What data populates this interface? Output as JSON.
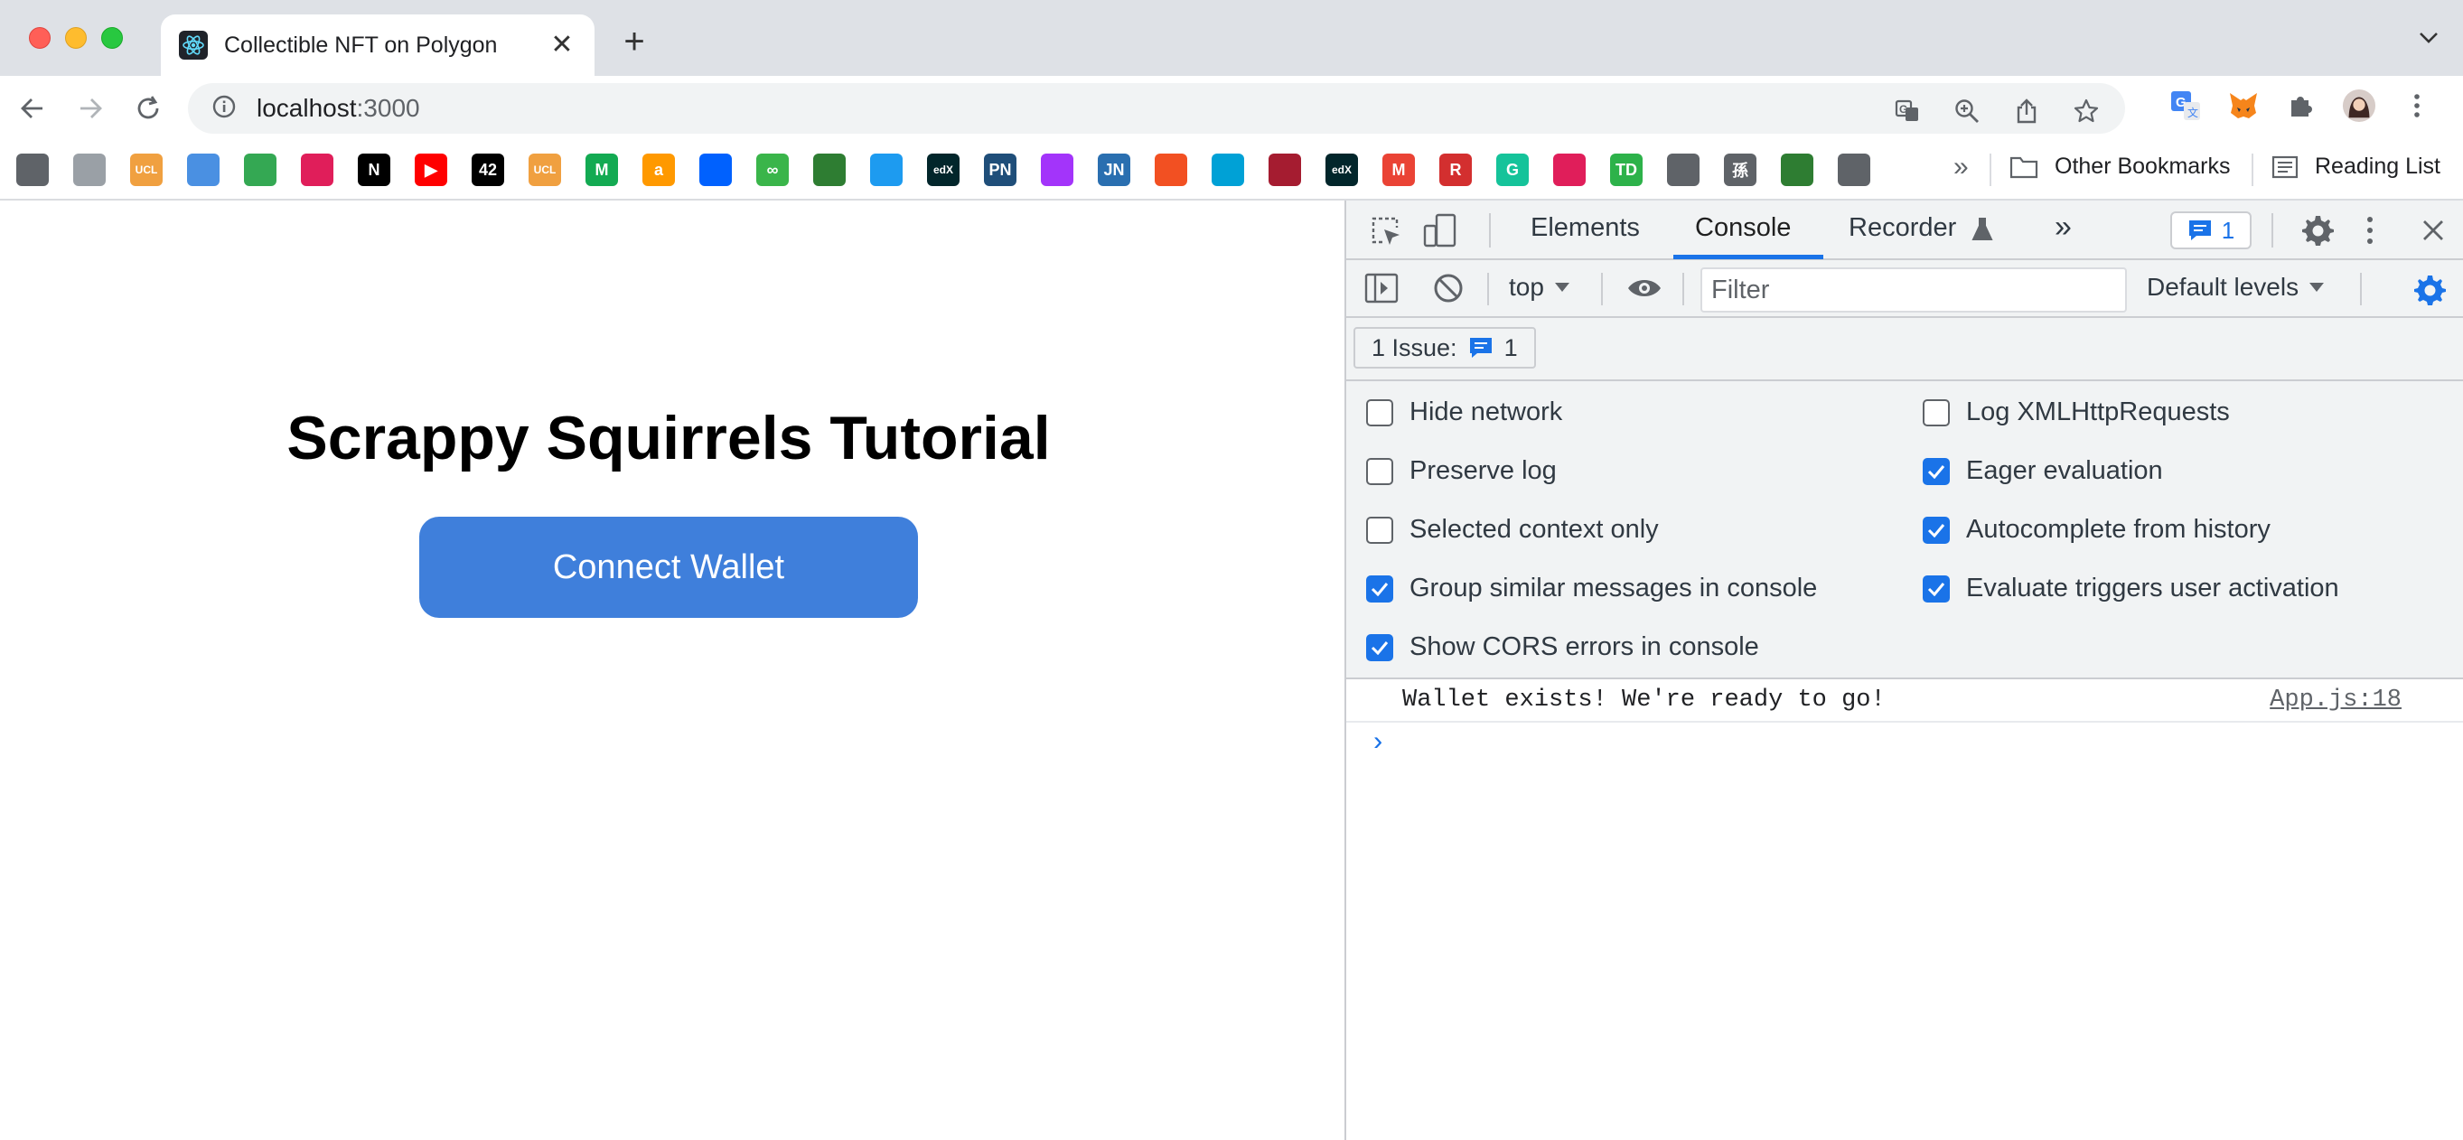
{
  "browser": {
    "tab_title": "Collectible NFT on Polygon",
    "new_tab_glyph": "+",
    "close_glyph": "✕",
    "url_host": "localhost",
    "url_port": ":3000"
  },
  "bookmarks": {
    "icons": [
      {
        "name": "globe-icon",
        "color": "#5f6368",
        "text": ""
      },
      {
        "name": "globe-gray-icon",
        "color": "#9aa0a6",
        "text": ""
      },
      {
        "name": "ucl-icon",
        "color": "#f0a040",
        "text": "UCL"
      },
      {
        "name": "stack-icon",
        "color": "#4a90e2",
        "text": ""
      },
      {
        "name": "google-drive-icon",
        "color": "#34a853",
        "text": ""
      },
      {
        "name": "slack-icon",
        "color": "#e01e5a",
        "text": ""
      },
      {
        "name": "notion-icon",
        "color": "#000000",
        "text": "N"
      },
      {
        "name": "youtube-icon",
        "color": "#ff0000",
        "text": "▶"
      },
      {
        "name": "42-icon",
        "color": "#000000",
        "text": "42"
      },
      {
        "name": "ucl-2-icon",
        "color": "#f0a040",
        "text": "UCL"
      },
      {
        "name": "mongo-icon",
        "color": "#13aa52",
        "text": "M"
      },
      {
        "name": "amazon-icon",
        "color": "#ff9900",
        "text": "a"
      },
      {
        "name": "dropbox-icon",
        "color": "#0061fe",
        "text": ""
      },
      {
        "name": "link-icon",
        "color": "#3ab54a",
        "text": "∞"
      },
      {
        "name": "frog-icon",
        "color": "#2e7d32",
        "text": ""
      },
      {
        "name": "twitter-icon",
        "color": "#1d9bf0",
        "text": ""
      },
      {
        "name": "edx-icon",
        "color": "#02262b",
        "text": "edX"
      },
      {
        "name": "pnas-icon",
        "color": "#1f4e79",
        "text": "PN"
      },
      {
        "name": "messenger-icon",
        "color": "#a334fa",
        "text": ""
      },
      {
        "name": "jn-icon",
        "color": "#2a6fb0",
        "text": "JN"
      },
      {
        "name": "microsoft-icon",
        "color": "#f25022",
        "text": ""
      },
      {
        "name": "bilibili-icon",
        "color": "#00a1d6",
        "text": ""
      },
      {
        "name": "harvard-icon",
        "color": "#a51c30",
        "text": ""
      },
      {
        "name": "edx-2-icon",
        "color": "#02262b",
        "text": "edX"
      },
      {
        "name": "gmail-icon",
        "color": "#ea4335",
        "text": "M"
      },
      {
        "name": "r-icon",
        "color": "#d32f2f",
        "text": "R"
      },
      {
        "name": "grammarly-icon",
        "color": "#15c39a",
        "text": "G"
      },
      {
        "name": "slack-2-icon",
        "color": "#e01e5a",
        "text": ""
      },
      {
        "name": "td-icon",
        "color": "#2db24a",
        "text": "TD"
      },
      {
        "name": "globe-2-icon",
        "color": "#5f6368",
        "text": ""
      },
      {
        "name": "sun-char-icon",
        "color": "#5f6368",
        "text": "孫"
      },
      {
        "name": "map-icon",
        "color": "#2e7d32",
        "text": ""
      },
      {
        "name": "globe-3-icon",
        "color": "#5f6368",
        "text": ""
      }
    ],
    "more_glyph": "»",
    "other_bookmarks": "Other Bookmarks",
    "reading_list": "Reading List"
  },
  "page": {
    "title": "Scrappy Squirrels Tutorial",
    "connect_button": "Connect Wallet"
  },
  "devtools": {
    "tabs": {
      "elements": "Elements",
      "console": "Console",
      "recorder": "Recorder",
      "more": "»"
    },
    "issue_count": "1",
    "context": "top",
    "filter_placeholder": "Filter",
    "levels": "Default levels",
    "issues_label": "1 Issue:",
    "issues_count": "1",
    "settings": {
      "left": [
        {
          "label": "Hide network",
          "checked": false
        },
        {
          "label": "Preserve log",
          "checked": false
        },
        {
          "label": "Selected context only",
          "checked": false
        },
        {
          "label": "Group similar messages in console",
          "checked": true
        },
        {
          "label": "Show CORS errors in console",
          "checked": true
        }
      ],
      "right": [
        {
          "label": "Log XMLHttpRequests",
          "checked": false
        },
        {
          "label": "Eager evaluation",
          "checked": true
        },
        {
          "label": "Autocomplete from history",
          "checked": true
        },
        {
          "label": "Evaluate triggers user activation",
          "checked": true
        }
      ]
    },
    "message": "Wallet exists! We're ready to go!",
    "message_source": "App.js:18",
    "prompt_glyph": "›"
  },
  "colors": {
    "accent": "#1a73e8",
    "connect_button": "#3f7fdb"
  }
}
